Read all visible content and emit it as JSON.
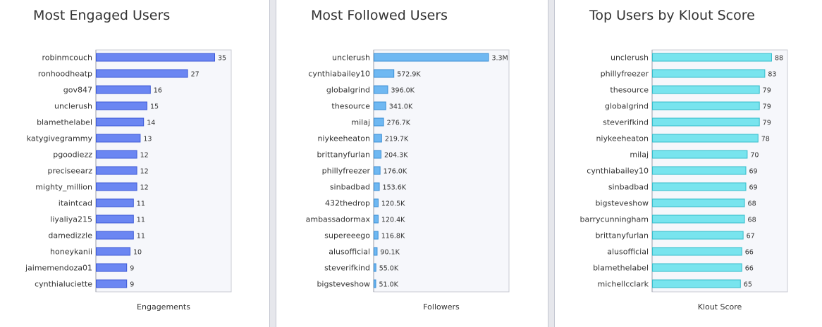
{
  "colors": {
    "engaged_bar": "#6b86f2",
    "engaged_stroke": "#3d5ad6",
    "followed_bar": "#6fb8f2",
    "followed_stroke": "#3c8fd4",
    "klout_bar": "#78e4ee",
    "klout_stroke": "#36bccb",
    "plot_bg": "#f6f7fb",
    "plot_border": "#c9cbd3"
  },
  "chart_data": [
    {
      "type": "bar",
      "orientation": "horizontal",
      "title": "Most Engaged Users",
      "xlabel": "Engagements",
      "ylabel": "",
      "categories": [
        "robinmcouch",
        "ronhoodheatp",
        "gov847",
        "unclerush",
        "blamethelabel",
        "katygivegrammy",
        "pgoodiezz",
        "preciseearz",
        "mighty_million",
        "itaintcad",
        "liyaliya215",
        "damedizzle",
        "honeykanii",
        "jaimemendoza01",
        "cynthialuciette"
      ],
      "values": [
        35,
        27,
        16,
        15,
        14,
        13,
        12,
        12,
        12,
        11,
        11,
        11,
        10,
        9,
        9
      ],
      "value_labels": [
        "35",
        "27",
        "16",
        "15",
        "14",
        "13",
        "12",
        "12",
        "12",
        "11",
        "11",
        "11",
        "10",
        "9",
        "9"
      ],
      "xlim": [
        0,
        40
      ],
      "grid": false
    },
    {
      "type": "bar",
      "orientation": "horizontal",
      "title": "Most Followed Users",
      "xlabel": "Followers",
      "ylabel": "",
      "categories": [
        "unclerush",
        "cynthiabailey10",
        "globalgrind",
        "thesource",
        "milaj",
        "niykeeheaton",
        "brittanyfurlan",
        "phillyfreezer",
        "sinbadbad",
        "432thedrop",
        "ambassadormax",
        "supereeego",
        "alusofficial",
        "steverifkind",
        "bigsteveshow"
      ],
      "values": [
        3300000,
        572900,
        396000,
        341000,
        276700,
        219700,
        204300,
        176000,
        153600,
        120500,
        120400,
        116800,
        90100,
        55000,
        51000
      ],
      "value_labels": [
        "3.3M",
        "572.9K",
        "396.0K",
        "341.0K",
        "276.7K",
        "219.7K",
        "204.3K",
        "176.0K",
        "153.6K",
        "120.5K",
        "120.4K",
        "116.8K",
        "90.1K",
        "55.0K",
        "51.0K"
      ],
      "xlim": [
        0,
        3900000
      ],
      "grid": false
    },
    {
      "type": "bar",
      "orientation": "horizontal",
      "title": "Top Users by Klout Score",
      "xlabel": "Klout Score",
      "ylabel": "",
      "categories": [
        "unclerush",
        "phillyfreezer",
        "thesource",
        "globalgrind",
        "steverifkind",
        "niykeeheaton",
        "milaj",
        "cynthiabailey10",
        "sinbadbad",
        "bigsteveshow",
        "barrycunningham",
        "brittanyfurlan",
        "alusofficial",
        "blamethelabel",
        "michellcclark"
      ],
      "values": [
        88,
        83,
        79,
        79,
        79,
        78,
        70,
        69,
        69,
        68,
        68,
        67,
        66,
        66,
        65
      ],
      "value_labels": [
        "88",
        "83",
        "79",
        "79",
        "79",
        "78",
        "70",
        "69",
        "69",
        "68",
        "68",
        "67",
        "66",
        "66",
        "65"
      ],
      "xlim": [
        0,
        100
      ],
      "grid": false
    }
  ]
}
